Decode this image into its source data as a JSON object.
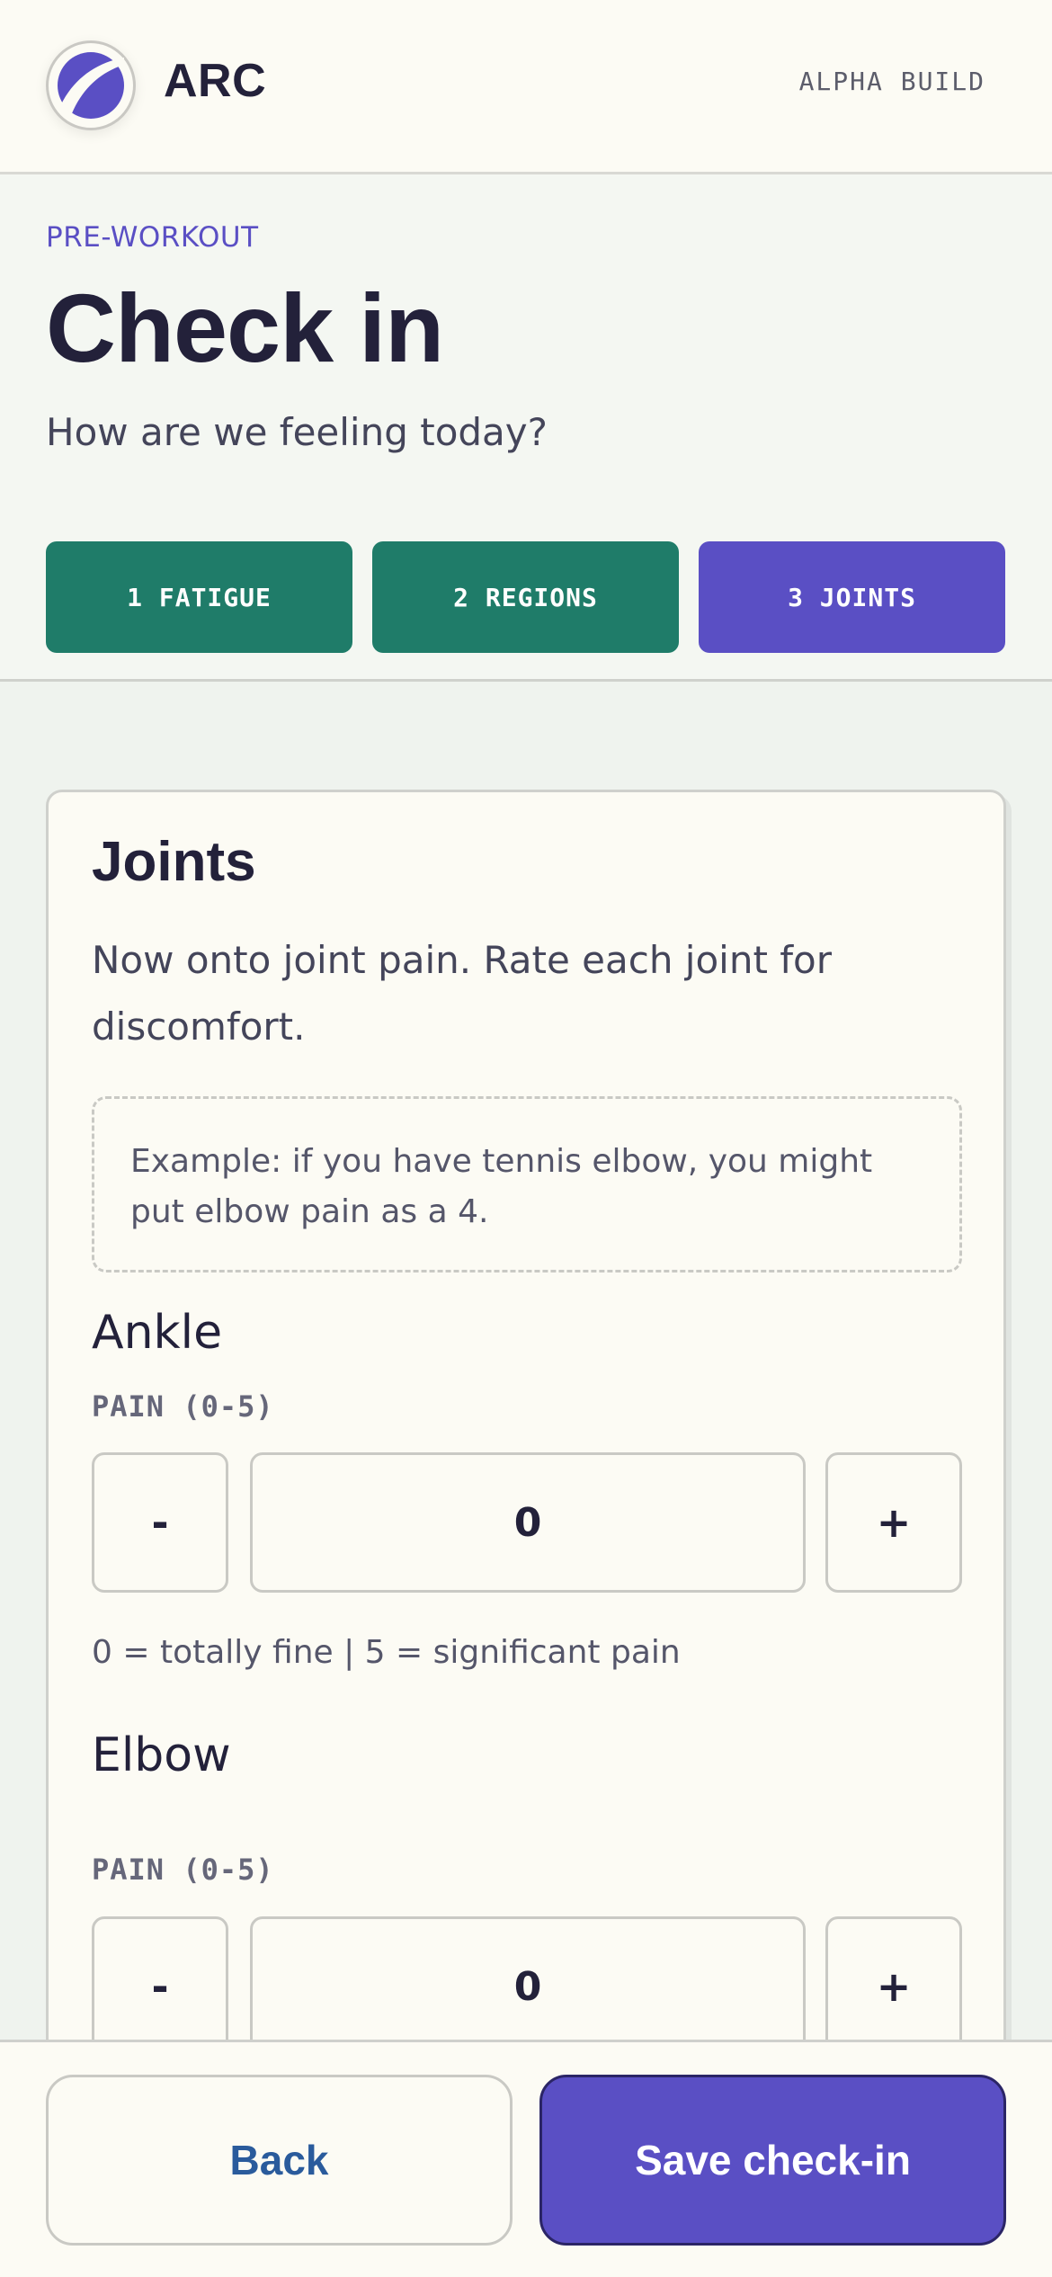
{
  "app": {
    "brand": "ARC",
    "build_label": "ALPHA BUILD"
  },
  "hero": {
    "eyebrow": "PRE-WORKOUT",
    "title": "Check in",
    "subtitle": "How are we feeling today?"
  },
  "steps": [
    {
      "label": "1 FATIGUE",
      "state": "done"
    },
    {
      "label": "2 REGIONS",
      "state": "done"
    },
    {
      "label": "3 JOINTS",
      "state": "active"
    }
  ],
  "card": {
    "title": "Joints",
    "description": "Now onto joint pain. Rate each joint for discomfort.",
    "example": "Example: if you have tennis elbow, you might put elbow pain as a 4.",
    "joints": [
      {
        "name": "Ankle",
        "pain_label": "PAIN (0-5)",
        "decrement_label": "-",
        "value": "0",
        "increment_label": "+",
        "hint": "0 = totally fine | 5 = significant pain"
      },
      {
        "name": "Elbow",
        "pain_label": "PAIN (0-5)",
        "decrement_label": "-",
        "value": "0",
        "increment_label": "+"
      }
    ]
  },
  "footer": {
    "back_label": "Back",
    "save_label": "Save check-in"
  },
  "colors": {
    "accent": "#5a4fc4",
    "step_done": "#1f7c69",
    "back_text": "#2a5b9c",
    "background": "#fcfbf4"
  },
  "icons": {
    "logo": "arc-logo-icon"
  }
}
